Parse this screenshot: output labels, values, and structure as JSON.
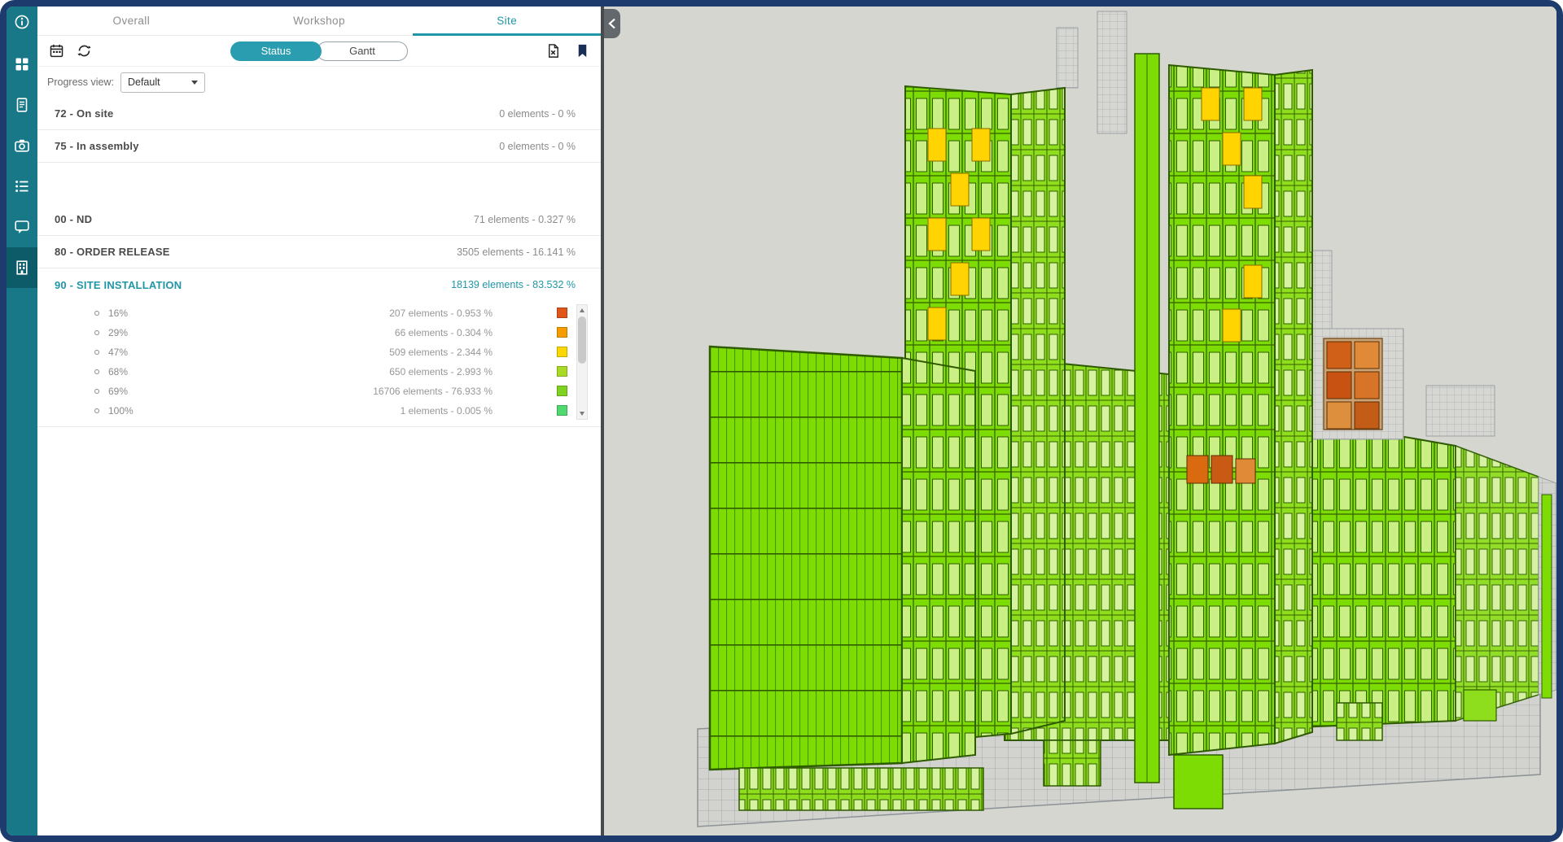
{
  "colors": {
    "frame_navy": "#1d3b6d",
    "accent_teal": "#2196a6",
    "sidebar_teal": "#187888",
    "sidebar_active": "#0d5a68",
    "status_button_teal": "#2b9db0",
    "model_green": "#7edc05",
    "viewer_background": "#d6d6d1"
  },
  "icons": {
    "sidebar": [
      "info-icon",
      "dashboard-icon",
      "document-icon",
      "camera-icon",
      "list-icon",
      "chat-icon",
      "building-icon"
    ],
    "toolbar": [
      "calendar-icon",
      "refresh-icon",
      "export-icon",
      "bookmark-icon"
    ],
    "viewer": [
      "collapse-chevron-icon"
    ],
    "misc": [
      "chevron-down-icon",
      "scroll-up-icon",
      "scroll-down-icon",
      "bullet-icon"
    ]
  },
  "tabs": {
    "overall": "Overall",
    "workshop": "Workshop",
    "site": "Site",
    "active": "Site"
  },
  "toolbar": {
    "status": "Status",
    "gantt": "Gantt"
  },
  "progress_view": {
    "label": "Progress view:",
    "selected": "Default"
  },
  "statuses": {
    "top": [
      {
        "name": "72 - On site",
        "value": "0 elements - 0 %"
      },
      {
        "name": "75 - In assembly",
        "value": "0 elements - 0 %"
      }
    ],
    "main": [
      {
        "name": "00 - ND",
        "value": "71 elements - 0.327 %"
      },
      {
        "name": "80 - ORDER RELEASE",
        "value": "3505 elements - 16.141 %"
      }
    ],
    "site_installation": {
      "name": "90 - SITE INSTALLATION",
      "value": "18139 elements - 83.532 %",
      "breakdown": [
        {
          "pct": "16%",
          "value": "207 elements - 0.953 %",
          "color": "#e0551a"
        },
        {
          "pct": "29%",
          "value": "66 elements - 0.304 %",
          "color": "#f59d00"
        },
        {
          "pct": "47%",
          "value": "509 elements - 2.344 %",
          "color": "#fdd800"
        },
        {
          "pct": "68%",
          "value": "650 elements - 2.993 %",
          "color": "#a8da26"
        },
        {
          "pct": "69%",
          "value": "16706 elements - 76.933 %",
          "color": "#7ed321"
        },
        {
          "pct": "100%",
          "value": "1 elements - 0.005 %",
          "color": "#4fd96f"
        }
      ]
    }
  }
}
